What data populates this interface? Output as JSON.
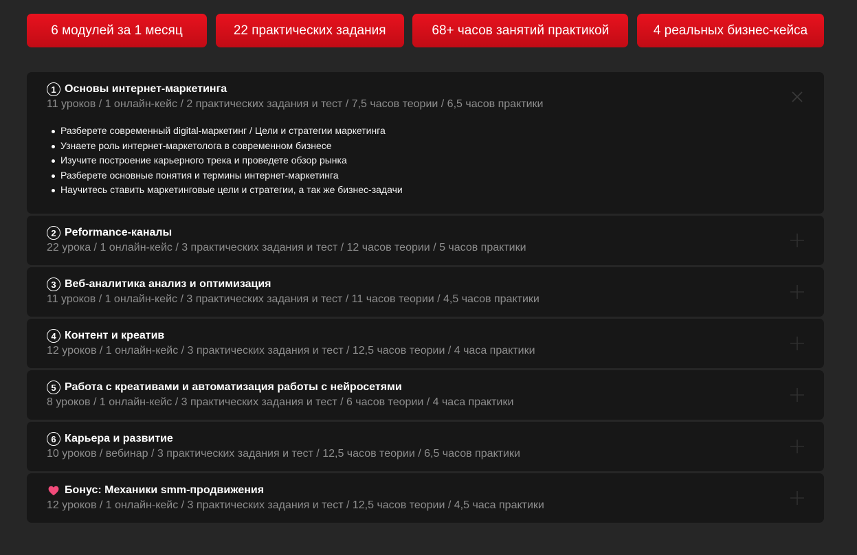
{
  "pills": [
    "6 модулей за 1 месяц",
    "22 практических задания",
    "68+ часов занятий практикой",
    "4 реальных бизнес-кейса"
  ],
  "modules": [
    {
      "number": "1",
      "title": "Основы интернет-маркетинга",
      "meta": "11 уроков / 1 онлайн-кейс / 2 практических задания и тест / 7,5 часов теории / 6,5 часов практики",
      "expanded": true,
      "toggle_icon": "close-icon",
      "items": [
        "Разберете современный digital-маркетинг / Цели и стратегии маркетинга",
        "Узнаете роль интернет-маркетолога в современном бизнесе",
        "Изучите построение карьерного трека и проведете обзор рынка",
        "Разберете основные понятия и термины интернет-маркетинга",
        "Научитесь ставить маркетинговые цели и стратегии, а так же бизнес-задачи"
      ]
    },
    {
      "number": "2",
      "title": "Peformance-каналы",
      "meta": "22 урока / 1 онлайн-кейс / 3 практических задания и тест / 12 часов теории / 5 часов практики",
      "expanded": false,
      "toggle_icon": "plus-icon"
    },
    {
      "number": "3",
      "title": "Веб-аналитика анализ и оптимизация",
      "meta": "11 уроков / 1 онлайн-кейс / 3 практических задания и тест / 11 часов теории / 4,5 часов практики",
      "expanded": false,
      "toggle_icon": "plus-icon"
    },
    {
      "number": "4",
      "title": "Контент и креатив",
      "meta": "12 уроков / 1 онлайн-кейс / 3 практических задания и тест / 12,5 часов теории / 4 часа практики",
      "expanded": false,
      "toggle_icon": "plus-icon"
    },
    {
      "number": "5",
      "title": "Работа с креативами и автоматизация работы с нейросетями",
      "meta": "8 уроков / 1 онлайн-кейс / 3 практических задания и тест / 6 часов теории / 4 часа практики",
      "expanded": false,
      "toggle_icon": "plus-icon"
    },
    {
      "number": "6",
      "title": "Карьера и развитие",
      "meta": "10 уроков / вебинар / 3 практических задания и тест / 12,5 часов теории / 6,5 часов практики",
      "expanded": false,
      "toggle_icon": "plus-icon"
    },
    {
      "icon": "heart-icon",
      "title": "Бонус: Механики smm-продвижения",
      "meta": "12 уроков / 1 онлайн-кейс / 3 практических задания и тест / 12,5 часов теории / 4,5 часа практики",
      "expanded": false,
      "toggle_icon": "plus-icon"
    }
  ],
  "colors": {
    "background": "#262626",
    "card": "#171717",
    "accent": "#e8121e",
    "meta_text": "#8d8d8d",
    "heart": "#f24b7a"
  }
}
